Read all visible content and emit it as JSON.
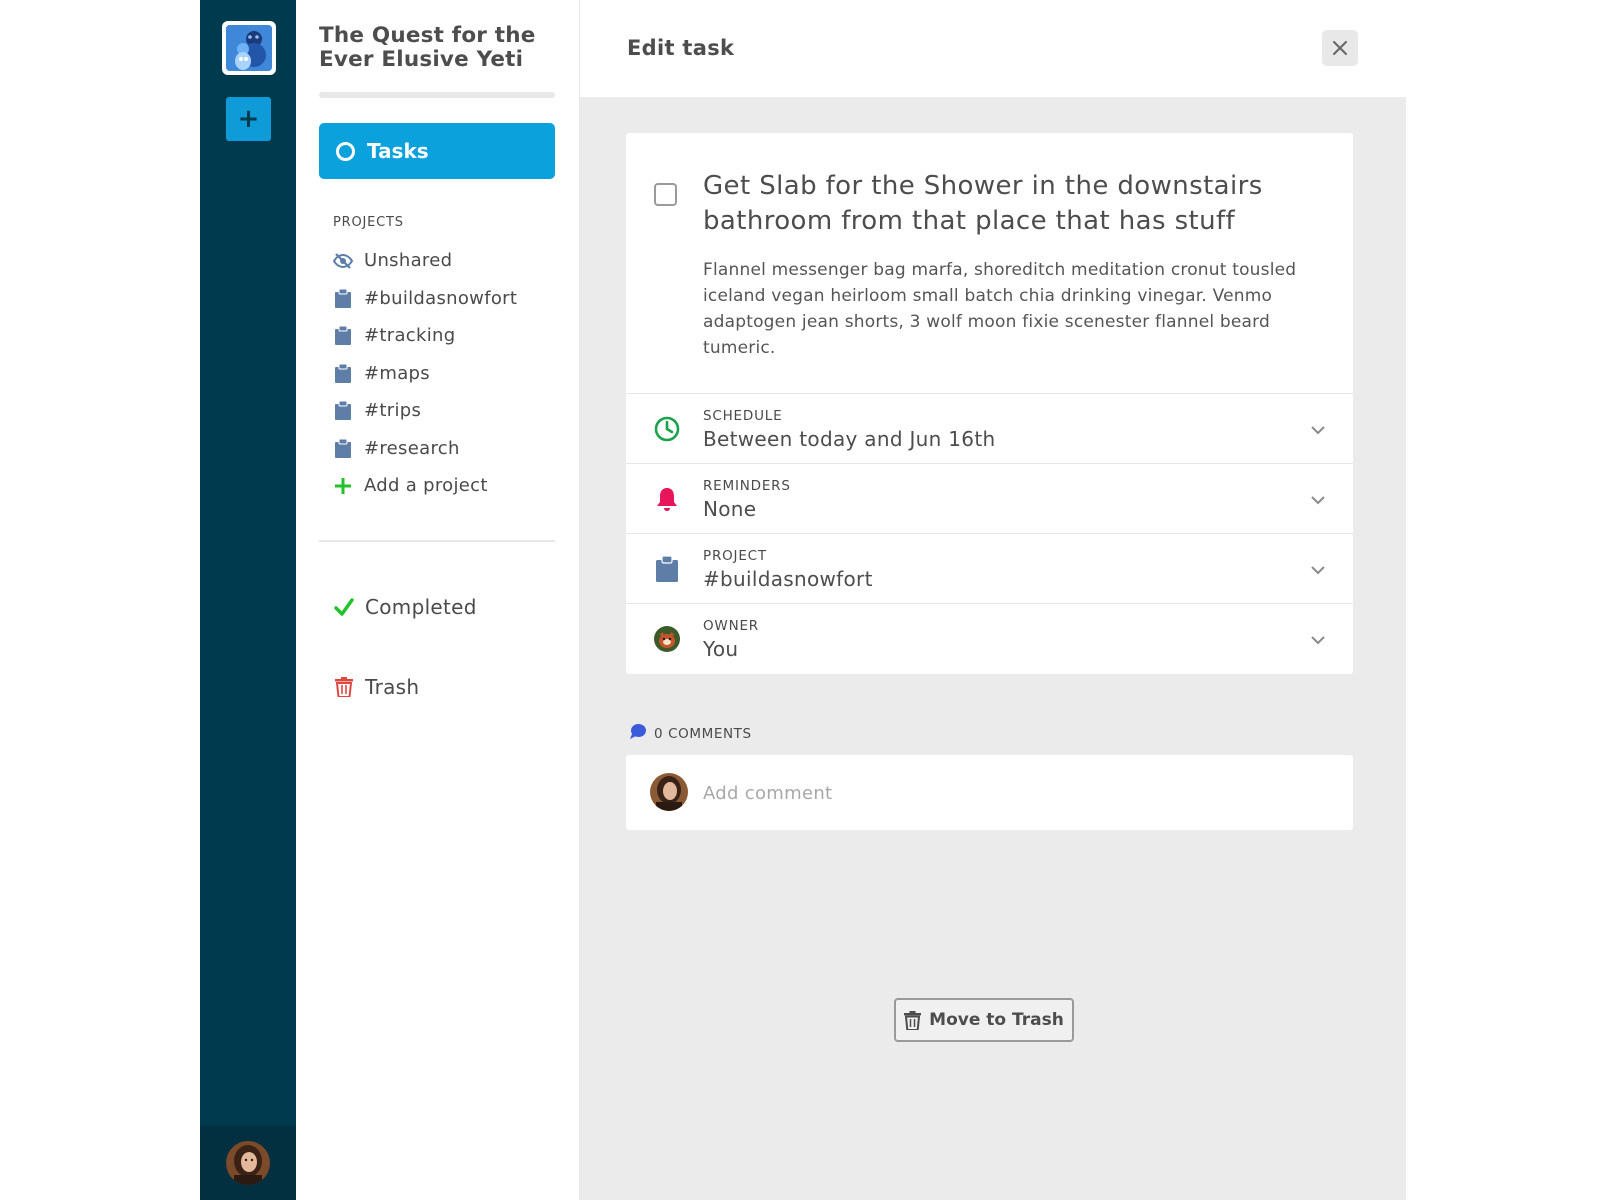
{
  "rail": {
    "logo_icon": "yeti-workspace-logo",
    "add_icon": "plus-icon",
    "add_symbol": "+"
  },
  "sidebar": {
    "project_title": "The Quest for the Ever Elusive Yeti",
    "tasks_label": "Tasks",
    "projects_heading": "PROJECTS",
    "projects": [
      {
        "label": "Unshared",
        "icon": "eye-slash-icon"
      },
      {
        "label": "#buildasnowfort",
        "icon": "clipboard-icon"
      },
      {
        "label": "#tracking",
        "icon": "clipboard-icon"
      },
      {
        "label": "#maps",
        "icon": "clipboard-icon"
      },
      {
        "label": "#trips",
        "icon": "clipboard-icon"
      },
      {
        "label": "#research",
        "icon": "clipboard-icon"
      }
    ],
    "add_project_label": "Add a project",
    "completed_label": "Completed",
    "trash_label": "Trash"
  },
  "main": {
    "title": "Edit task",
    "task": {
      "title": "Get Slab for the Shower in the downstairs bathroom from that place that has stuff",
      "description": "Flannel messenger bag marfa, shoreditch meditation cronut tousled iceland vegan heirloom small batch chia drinking vinegar. Venmo adaptogen jean shorts, 3 wolf moon fixie scenester flannel beard tumeric.",
      "completed": false
    },
    "fields": {
      "schedule": {
        "label": "SCHEDULE",
        "value": "Between today and Jun 16th"
      },
      "reminders": {
        "label": "REMINDERS",
        "value": "None"
      },
      "project": {
        "label": "PROJECT",
        "value": "#buildasnowfort"
      },
      "owner": {
        "label": "OWNER",
        "value": "You"
      }
    },
    "comments": {
      "count_label": "0 COMMENTS",
      "placeholder": "Add comment"
    },
    "move_to_trash_label": "Move to Trash"
  },
  "colors": {
    "rail": "#003a4f",
    "accent": "#0aa1dd",
    "green": "#23c12a",
    "schedule_green": "#1aa34a",
    "bell_pink": "#e8155a",
    "project_blue": "#5e7ea8",
    "trash_red": "#e0483f",
    "comment_blue": "#3b5bdb"
  }
}
